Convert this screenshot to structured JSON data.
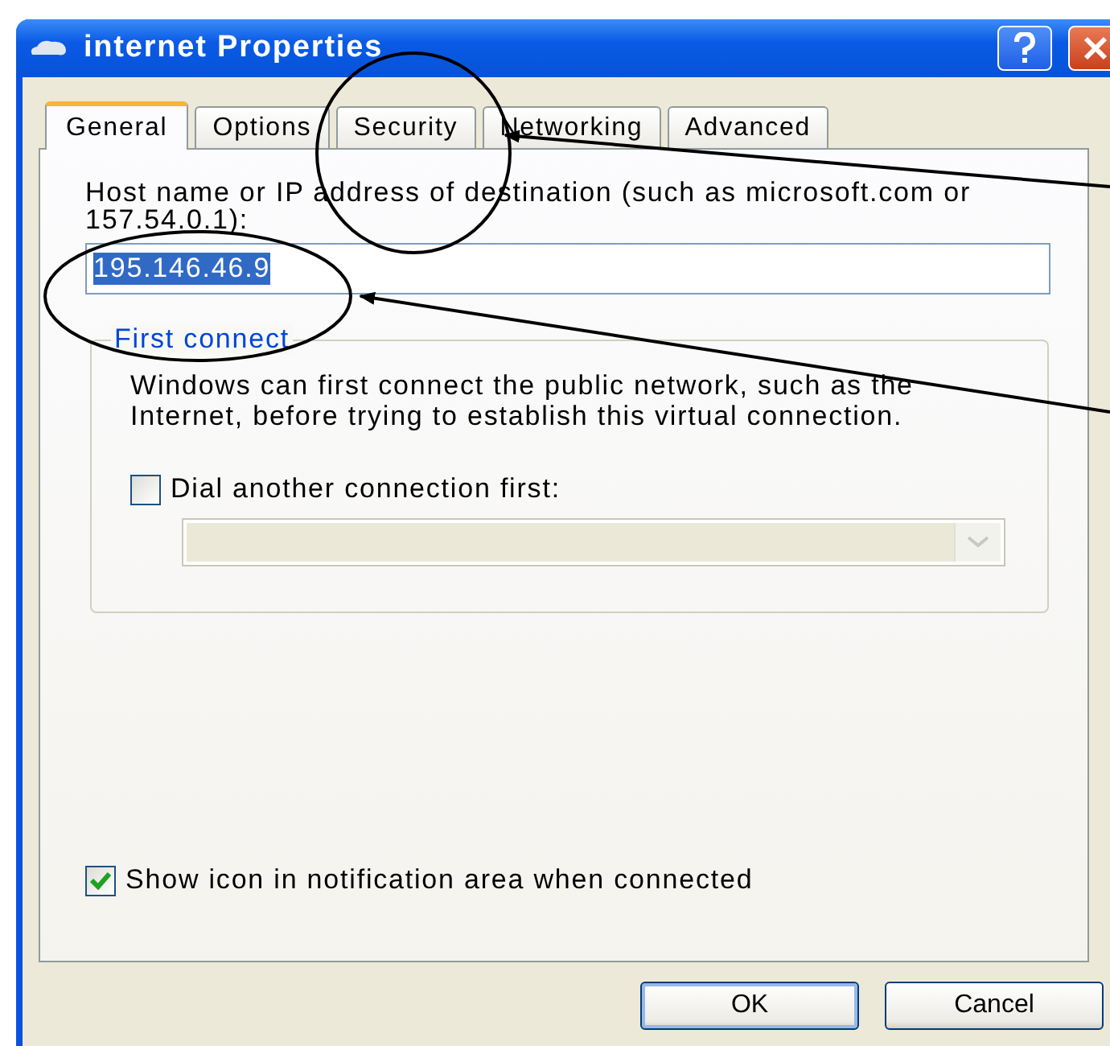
{
  "window": {
    "title": "internet Properties"
  },
  "tabs": [
    {
      "label": "General",
      "selected": true
    },
    {
      "label": "Options",
      "selected": false
    },
    {
      "label": "Security",
      "selected": false
    },
    {
      "label": "Networking",
      "selected": false
    },
    {
      "label": "Advanced",
      "selected": false
    }
  ],
  "destination": {
    "label": "Host name or IP address of destination (such as microsoft.com or 157.54.0.1):",
    "value": "195.146.46.9"
  },
  "first_connect": {
    "legend": "First connect",
    "description": "Windows can first connect the public network, such as the Internet, before trying to establish this virtual connection.",
    "dial_checkbox": {
      "label": "Dial another connection first:",
      "checked": false
    },
    "connection_dropdown": {
      "disabled": true
    }
  },
  "show_icon": {
    "label": "Show icon in notification area when connected",
    "checked": true
  },
  "buttons": [
    {
      "label": "OK",
      "default": true
    },
    {
      "label": "Cancel",
      "default": false
    }
  ]
}
